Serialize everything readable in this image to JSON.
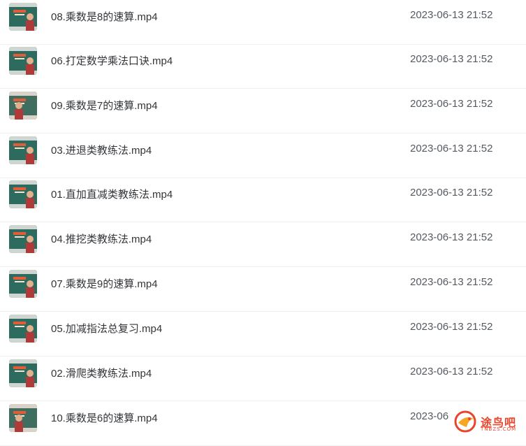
{
  "files": [
    {
      "name": "08.乘数是8的速算.mp4",
      "modified": "2023-06-13 21:52",
      "thumb": "blackboard-teacher"
    },
    {
      "name": "06.打定数学乘法口诀.mp4",
      "modified": "2023-06-13 21:52",
      "thumb": "blackboard-teacher"
    },
    {
      "name": "09.乘数是7的速算.mp4",
      "modified": "2023-06-13 21:52",
      "thumb": "blackboard-teacher-closeup"
    },
    {
      "name": "03.进退类教练法.mp4",
      "modified": "2023-06-13 21:52",
      "thumb": "blackboard-teacher"
    },
    {
      "name": "01.直加直减类教练法.mp4",
      "modified": "2023-06-13 21:52",
      "thumb": "blackboard-teacher"
    },
    {
      "name": "04.推挖类教练法.mp4",
      "modified": "2023-06-13 21:52",
      "thumb": "blackboard-teacher"
    },
    {
      "name": "07.乘数是9的速算.mp4",
      "modified": "2023-06-13 21:52",
      "thumb": "blackboard-teacher"
    },
    {
      "name": "05.加减指法总复习.mp4",
      "modified": "2023-06-13 21:52",
      "thumb": "blackboard-teacher"
    },
    {
      "name": "02.滑爬类教练法.mp4",
      "modified": "2023-06-13 21:52",
      "thumb": "blackboard-teacher"
    },
    {
      "name": "10.乘数是6的速算.mp4",
      "modified": "2023-06",
      "thumb": "blackboard-teacher-closeup"
    }
  ],
  "watermark": {
    "text": "途鸟吧",
    "subtext": "TNBZS.COM",
    "icon": "bird-logo-icon"
  },
  "colors": {
    "board": "#2d6b5e",
    "accent": "#e8452c"
  }
}
